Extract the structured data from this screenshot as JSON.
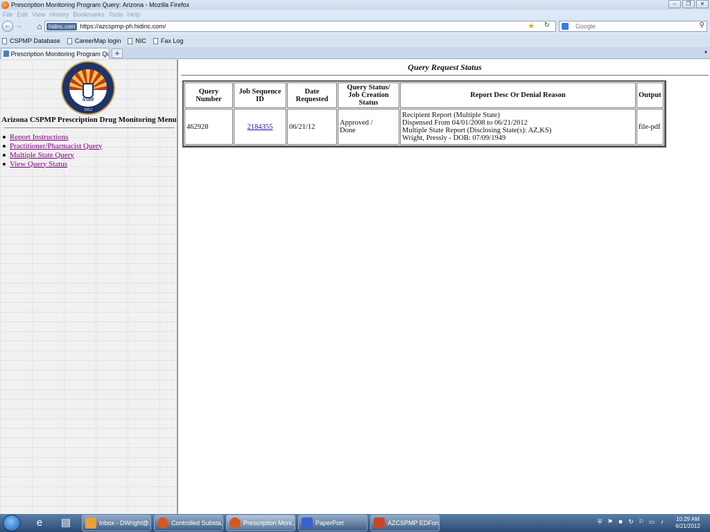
{
  "window": {
    "title": "Prescription Monitoring Program Query: Arizona - Mozilla Firefox"
  },
  "menu": [
    "File",
    "Edit",
    "View",
    "History",
    "Bookmarks",
    "Tools",
    "Help"
  ],
  "nav": {
    "site_badge": "hidinc.com",
    "url": "https://azcspmp-ph.hidinc.com/",
    "search_placeholder": "Google"
  },
  "bookmarks": [
    "CSPMP Database",
    "CareerMap login",
    "NIC",
    "Fax Log"
  ],
  "tab": {
    "label": "Prescription Monitoring Program Query:..."
  },
  "sidebar": {
    "seal_text": "ASBP",
    "seal_year": "1912",
    "title": "Arizona CSPMP  Prescription Drug Monitoring Menu",
    "links": [
      "Report Instructions",
      "Practitioner/Pharmacist Query",
      "Multiple State Query",
      "View Query Status"
    ]
  },
  "main": {
    "title": "Query Request Status",
    "table": {
      "headers": [
        "Query Number",
        "Job Sequence ID",
        "Date Requested",
        "Query Status/",
        "Job Creation Status",
        "Report Desc Or Denial Reason",
        "Output"
      ],
      "row": {
        "query_number": "462928",
        "job_sequence_id": "2184355",
        "date_requested": "06/21/12",
        "status_line1": "Approved /",
        "status_line2": "Done",
        "desc_line1": "Recipient Report (Multiple State)",
        "desc_line2": "Dispensed From 04/01/2008 to 06/21/2012",
        "desc_line3": "Multiple State Report (Disclosing State(s): AZ,KS)",
        "desc_line4": "Wright, Pressly - DOB: 07/09/1949",
        "output": "file-pdf"
      }
    }
  },
  "taskbar": {
    "tasks": [
      "Inbox - DWright@...",
      "Controlled Substa...",
      "Prescription Moni...",
      "PaperPort",
      "AZCSPMP EDForu..."
    ],
    "time": "10:29 AM",
    "date": "6/21/2012"
  }
}
